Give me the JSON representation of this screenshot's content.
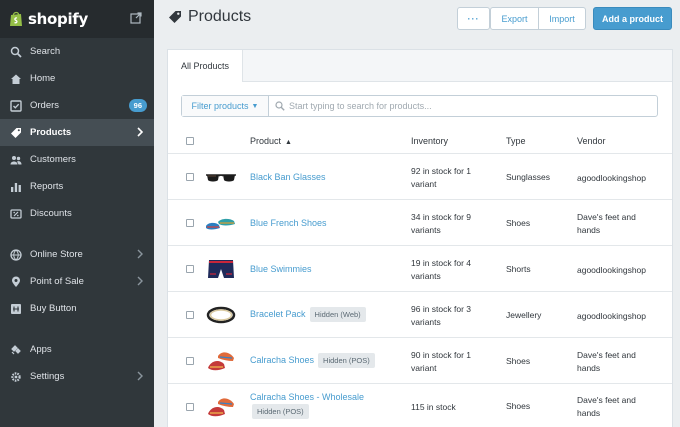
{
  "brand": {
    "name": "shopify"
  },
  "sidebar": {
    "items": [
      {
        "label": "Search",
        "icon": "search-icon"
      },
      {
        "label": "Home",
        "icon": "home-icon"
      },
      {
        "label": "Orders",
        "icon": "orders-icon",
        "badge": "96"
      },
      {
        "label": "Products",
        "icon": "tag-icon",
        "active": true
      },
      {
        "label": "Customers",
        "icon": "customers-icon"
      },
      {
        "label": "Reports",
        "icon": "reports-icon"
      },
      {
        "label": "Discounts",
        "icon": "discounts-icon"
      },
      {
        "label": "Online Store",
        "icon": "globe-icon"
      },
      {
        "label": "Point of Sale",
        "icon": "pin-icon"
      },
      {
        "label": "Buy Button",
        "icon": "buy-button-icon"
      },
      {
        "label": "Apps",
        "icon": "apps-icon"
      },
      {
        "label": "Settings",
        "icon": "gear-icon"
      }
    ]
  },
  "header": {
    "title": "Products",
    "more_label": "···",
    "export_label": "Export",
    "import_label": "Import",
    "add_label": "Add a product"
  },
  "tabs": [
    {
      "label": "All Products"
    }
  ],
  "filter": {
    "button_label": "Filter products",
    "search_placeholder": "Start typing to search for products..."
  },
  "table": {
    "columns": {
      "product": "Product",
      "inventory": "Inventory",
      "type": "Type",
      "vendor": "Vendor"
    },
    "rows": [
      {
        "name": "Black Ban Glasses",
        "tag": "",
        "inventory": "92 in stock for 1 variant",
        "type": "Sunglasses",
        "vendor": "agoodlookingshop",
        "thumb": "sunglasses"
      },
      {
        "name": "Blue French Shoes",
        "tag": "",
        "inventory": "34 in stock for 9 variants",
        "type": "Shoes",
        "vendor": "Dave's feet and hands",
        "thumb": "blue-shoes"
      },
      {
        "name": "Blue Swimmies",
        "tag": "",
        "inventory": "19 in stock for 4 variants",
        "type": "Shorts",
        "vendor": "agoodlookingshop",
        "thumb": "shorts"
      },
      {
        "name": "Bracelet Pack",
        "tag": "Hidden (Web)",
        "inventory": "96 in stock for 3 variants",
        "type": "Jewellery",
        "vendor": "agoodlookingshop",
        "thumb": "bracelet"
      },
      {
        "name": "Calracha Shoes",
        "tag": "Hidden (POS)",
        "inventory": "90 in stock for 1 variant",
        "type": "Shoes",
        "vendor": "Dave's feet and hands",
        "thumb": "red-shoes"
      },
      {
        "name": "Calracha Shoes - Wholesale",
        "tag": "Hidden (POS)",
        "inventory": "115 in stock",
        "type": "Shoes",
        "vendor": "Dave's feet and hands",
        "thumb": "red-shoes"
      }
    ]
  },
  "colors": {
    "accent": "#479ccf",
    "sidebar": "#30373b",
    "brand_green": "#95bf47"
  }
}
